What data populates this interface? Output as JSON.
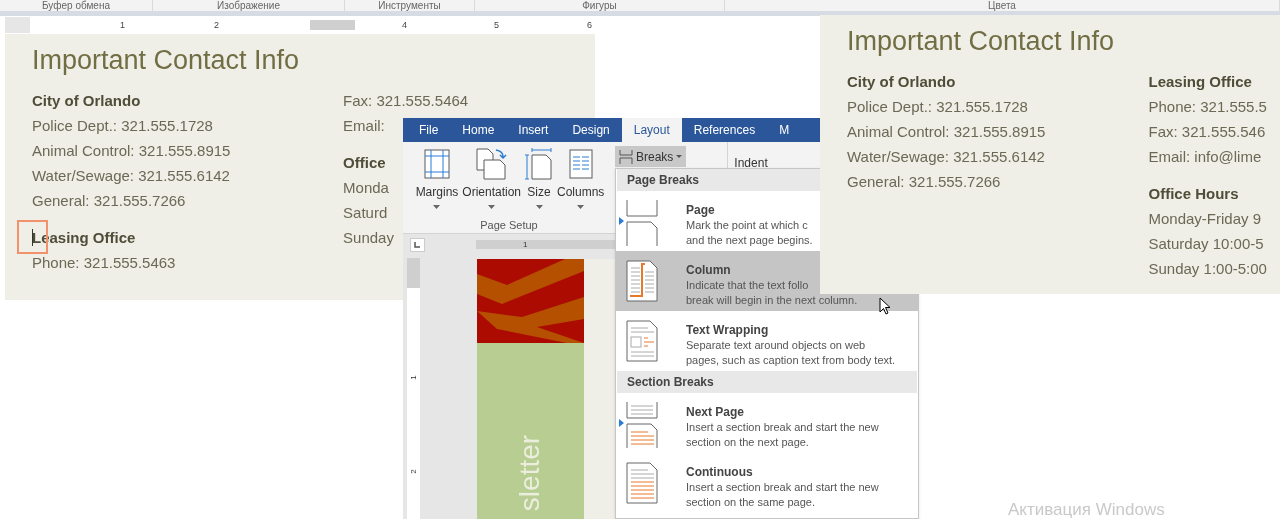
{
  "top_ribbon": {
    "groups": [
      "Буфер обмена",
      "Изображение",
      "Инструменты",
      "Фигуры",
      "Цвета"
    ]
  },
  "ruler": {
    "marks": [
      "1",
      "2",
      "4",
      "5",
      "6"
    ]
  },
  "left_document": {
    "title": "Important Contact Info",
    "columns": [
      [
        {
          "heading": "City of Orlando",
          "lines": [
            "Police Dept.: 321.555.1728",
            "Animal Control: 321.555.8915",
            "Water/Sewage: 321.555.6142",
            "General: 321.555.7266"
          ]
        },
        {
          "heading": "Leasing Office",
          "lines": [
            "Phone: 321.555.5463"
          ],
          "highlighted": true
        }
      ],
      [
        {
          "lines": [
            "Fax: 321.555.5464",
            "Email:"
          ]
        },
        {
          "heading": "Office",
          "lines": [
            "Monda",
            "Saturd",
            "Sunday"
          ]
        }
      ]
    ]
  },
  "word_window": {
    "tabs": [
      {
        "label": "File",
        "selected": false
      },
      {
        "label": "Home",
        "selected": false
      },
      {
        "label": "Insert",
        "selected": false
      },
      {
        "label": "Design",
        "selected": false
      },
      {
        "label": "Layout",
        "selected": true
      },
      {
        "label": "References",
        "selected": false
      },
      {
        "label": "M",
        "selected": false
      }
    ],
    "buttons": [
      {
        "label": "Margins",
        "kind": "margins"
      },
      {
        "label": "Orientation",
        "kind": "orientation"
      },
      {
        "label": "Size",
        "kind": "size"
      },
      {
        "label": "Columns",
        "kind": "columns"
      }
    ],
    "group_label": "Page Setup",
    "breaks_button": {
      "label": "Breaks",
      "pressed": true
    },
    "indent_label": "Indent",
    "ruler_mark": "1",
    "vertical_ruler_marks": [
      "1",
      "2"
    ],
    "page_text": "sletter"
  },
  "breaks_menu": {
    "sections": [
      {
        "title": "Page Breaks",
        "items": [
          {
            "kind": "page",
            "title": "Page",
            "description": [
              "Mark the point at which c",
              "and the next page begins."
            ],
            "selected": false,
            "flagged": true
          },
          {
            "kind": "column",
            "title": "Column",
            "description": [
              "Indicate that the text follo",
              "break will begin in the next column."
            ],
            "selected": true,
            "flagged": false
          },
          {
            "kind": "text_wrapping",
            "title": "Text Wrapping",
            "description": [
              "Separate text around objects on web",
              "pages, such as caption text from body text."
            ],
            "selected": false,
            "flagged": false
          }
        ]
      },
      {
        "title": "Section Breaks",
        "items": [
          {
            "kind": "next_page",
            "title": "Next Page",
            "description": [
              "Insert a section break and start the new",
              "section on the next page."
            ],
            "selected": false,
            "flagged": true
          },
          {
            "kind": "continuous",
            "title": "Continuous",
            "description": [
              "Insert a section break and start the new",
              "section on the same page."
            ],
            "selected": false,
            "flagged": false
          }
        ]
      }
    ]
  },
  "right_document": {
    "title": "Important Contact Info",
    "columns": [
      [
        {
          "heading": "City of Orlando",
          "lines": [
            "Police Dept.: 321.555.1728",
            "Animal Control: 321.555.8915",
            "Water/Sewage: 321.555.6142",
            "General: 321.555.7266"
          ]
        }
      ],
      [
        {
          "heading": "Leasing Office",
          "lines": [
            "Phone: 321.555.5",
            "Fax: 321.555.546",
            "Email: info@lime"
          ]
        },
        {
          "heading": "Office Hours",
          "lines": [
            "Monday-Friday 9",
            "Saturday 10:00-5",
            "Sunday 1:00-5:00"
          ]
        }
      ]
    ]
  },
  "activation_notice": "Активация Windows"
}
